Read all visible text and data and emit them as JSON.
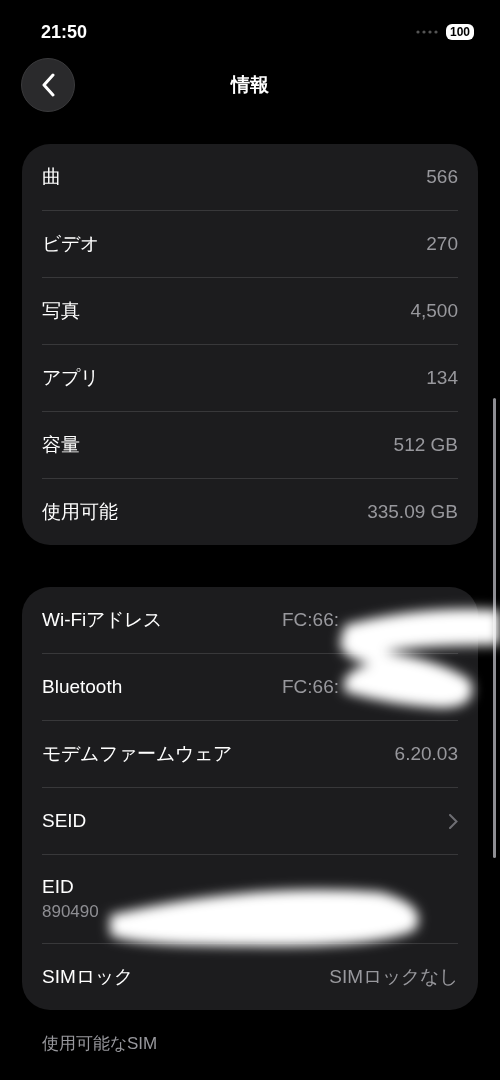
{
  "status_bar": {
    "time": "21:50",
    "battery": "100"
  },
  "nav": {
    "title": "情報"
  },
  "groups": [
    {
      "rows": [
        {
          "kind": "value",
          "label": "曲",
          "value": "566"
        },
        {
          "kind": "value",
          "label": "ビデオ",
          "value": "270"
        },
        {
          "kind": "value",
          "label": "写真",
          "value": "4,500"
        },
        {
          "kind": "value",
          "label": "アプリ",
          "value": "134"
        },
        {
          "kind": "value",
          "label": "容量",
          "value": "512 GB"
        },
        {
          "kind": "value",
          "label": "使用可能",
          "value": "335.09 GB"
        }
      ]
    },
    {
      "rows": [
        {
          "kind": "masked",
          "label": "Wi-Fiアドレス",
          "value": "FC:66:"
        },
        {
          "kind": "masked",
          "label": "Bluetooth",
          "value": "FC:66:"
        },
        {
          "kind": "value",
          "label": "モデムファームウェア",
          "value": "6.20.03"
        },
        {
          "kind": "chevron",
          "label": "SEID"
        },
        {
          "kind": "two_line",
          "label": "EID",
          "value": "890490"
        },
        {
          "kind": "value",
          "label": "SIMロック",
          "value": "SIMロックなし"
        }
      ]
    }
  ],
  "section_header": "使用可能なSIM"
}
